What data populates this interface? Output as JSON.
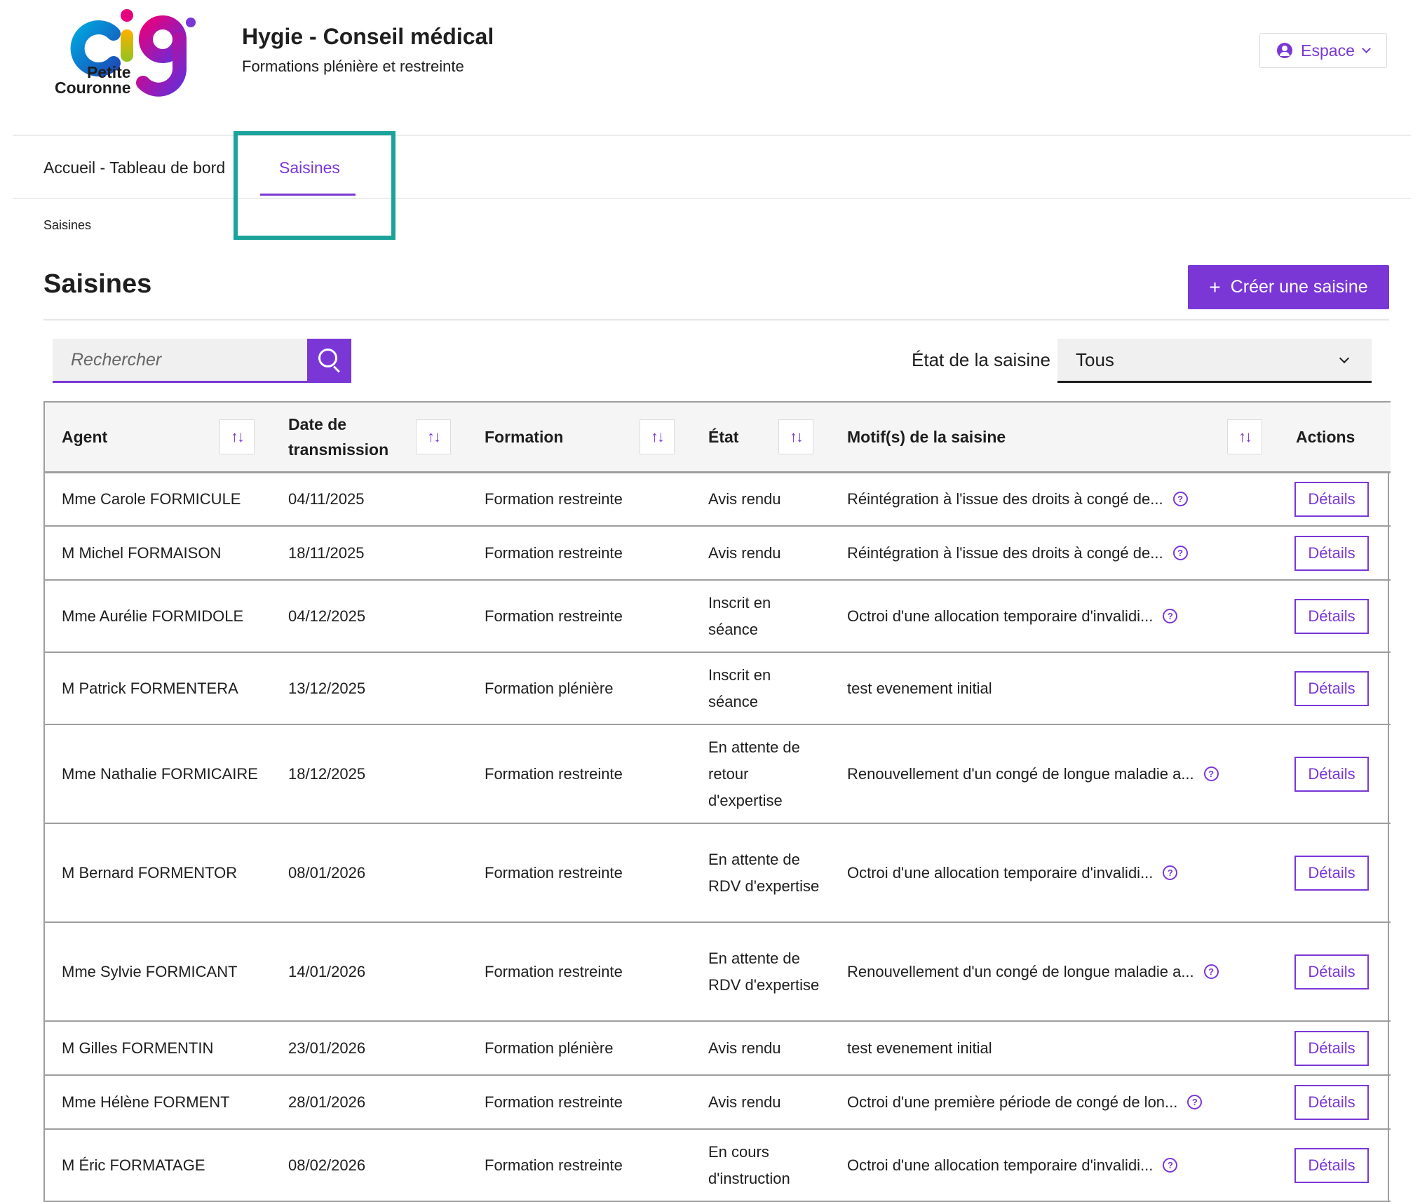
{
  "header": {
    "logo_text": "cig",
    "logo_sub_line1": "Petite",
    "logo_sub_line2": "Couronne",
    "title": "Hygie - Conseil médical",
    "subtitle": "Formations plénière et restreinte",
    "espace_label": "Espace"
  },
  "nav": {
    "items": [
      {
        "label": "Accueil - Tableau de bord",
        "active": false
      },
      {
        "label": "Saisines",
        "active": true
      }
    ]
  },
  "breadcrumb": "Saisines",
  "page": {
    "title": "Saisines",
    "create_button": "Créer une saisine",
    "create_plus": "+"
  },
  "filters": {
    "search_placeholder": "Rechercher",
    "state_label": "État de la saisine",
    "state_value": "Tous"
  },
  "table": {
    "headers": {
      "agent": "Agent",
      "date": "Date de transmission",
      "formation": "Formation",
      "etat": "État",
      "motif": "Motif(s) de la saisine",
      "actions": "Actions"
    },
    "details_label": "Détails",
    "rows": [
      {
        "agent": "Mme Carole FORMICULE",
        "date": "04/11/2025",
        "formation": "Formation restreinte",
        "etat": "Avis rendu",
        "motif": "Réintégration à l'issue des droits à congé de...",
        "help": true
      },
      {
        "agent": "M Michel FORMAISON",
        "date": "18/11/2025",
        "formation": "Formation restreinte",
        "etat": "Avis rendu",
        "motif": "Réintégration à l'issue des droits à congé de...",
        "help": true
      },
      {
        "agent": "Mme Aurélie FORMIDOLE",
        "date": "04/12/2025",
        "formation": "Formation restreinte",
        "etat": "Inscrit en séance",
        "motif": "Octroi d'une allocation temporaire d'invalidi...",
        "help": true
      },
      {
        "agent": "M Patrick FORMENTERA",
        "date": "13/12/2025",
        "formation": "Formation plénière",
        "etat": "Inscrit en séance",
        "motif": "test evenement initial",
        "help": false
      },
      {
        "agent": "Mme Nathalie FORMICAIRE",
        "date": "18/12/2025",
        "formation": "Formation restreinte",
        "etat": "En attente de retour d'expertise",
        "motif": "Renouvellement d'un congé de longue maladie a...",
        "help": true
      },
      {
        "agent": "M Bernard FORMENTOR",
        "date": "08/01/2026",
        "formation": "Formation restreinte",
        "etat": "En attente de RDV d'expertise",
        "motif": "Octroi d'une allocation temporaire d'invalidi...",
        "help": true
      },
      {
        "agent": "Mme Sylvie FORMICANT",
        "date": "14/01/2026",
        "formation": "Formation restreinte",
        "etat": "En attente de RDV d'expertise",
        "motif": "Renouvellement d'un congé de longue maladie a...",
        "help": true
      },
      {
        "agent": "M Gilles FORMENTIN",
        "date": "23/01/2026",
        "formation": "Formation plénière",
        "etat": "Avis rendu",
        "motif": "test evenement initial",
        "help": false
      },
      {
        "agent": "Mme Hélène FORMENT",
        "date": "28/01/2026",
        "formation": "Formation restreinte",
        "etat": "Avis rendu",
        "motif": "Octroi d'une première période de congé de lon...",
        "help": true
      },
      {
        "agent": "M Éric FORMATAGE",
        "date": "08/02/2026",
        "formation": "Formation restreinte",
        "etat": "En cours d'instruction",
        "motif": "Octroi d'une allocation temporaire d'invalidi...",
        "help": true
      }
    ]
  },
  "icons": {
    "sort": "sort-arrows-icon",
    "help": "question-circle-icon",
    "search": "search-icon",
    "user": "user-circle-icon",
    "chevron": "chevron-down-icon"
  },
  "colors": {
    "accent": "#7a37d6",
    "highlight": "#1aa39a",
    "border": "#9e9e9e"
  }
}
